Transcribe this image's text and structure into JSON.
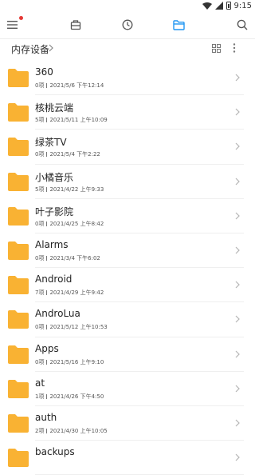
{
  "status": {
    "time": "9:15"
  },
  "toolbar": {
    "icons": [
      "menu-icon",
      "box-icon",
      "clock-icon",
      "folder-icon",
      "search-icon"
    ],
    "active": "folder-icon",
    "accent": "#2196f3"
  },
  "path": {
    "label": "内存设备"
  },
  "folder_color": "#f9b233",
  "items": [
    {
      "name": "360",
      "count": "0项",
      "date": "2021/5/6 下午12:14"
    },
    {
      "name": "核桃云端",
      "count": "5项",
      "date": "2021/5/11 上午10:09"
    },
    {
      "name": "绿茶TV",
      "count": "0项",
      "date": "2021/5/4 下午2:22"
    },
    {
      "name": "小橘音乐",
      "count": "5项",
      "date": "2021/4/22 上午9:33"
    },
    {
      "name": "叶子影院",
      "count": "0项",
      "date": "2021/4/25 上午8:42"
    },
    {
      "name": "Alarms",
      "count": "0项",
      "date": "2021/3/4 下午6:02"
    },
    {
      "name": "Android",
      "count": "7项",
      "date": "2021/4/29 上午9:42"
    },
    {
      "name": "AndroLua",
      "count": "0项",
      "date": "2021/5/12 上午10:53"
    },
    {
      "name": "Apps",
      "count": "0项",
      "date": "2021/5/16 上午9:10"
    },
    {
      "name": "at",
      "count": "1项",
      "date": "2021/4/26 下午4:50"
    },
    {
      "name": "auth",
      "count": "2项",
      "date": "2021/4/30 上午10:05"
    },
    {
      "name": "backups",
      "count": "",
      "date": ""
    }
  ]
}
